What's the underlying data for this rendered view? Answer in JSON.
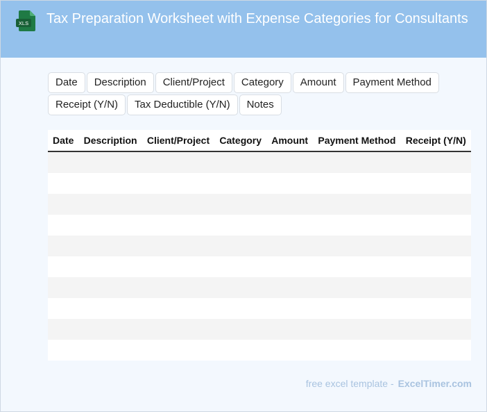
{
  "header": {
    "title": "Tax Preparation Worksheet with Expense Categories for Consultants",
    "icon_label": "XLS"
  },
  "columns": [
    "Date",
    "Description",
    "Client/Project",
    "Category",
    "Amount",
    "Payment Method",
    "Receipt (Y/N)",
    "Tax Deductible (Y/N)",
    "Notes"
  ],
  "table": {
    "headers": [
      "Date",
      "Description",
      "Client/Project",
      "Category",
      "Amount",
      "Payment Method",
      "Receipt (Y/N)"
    ],
    "empty_row_count": 10
  },
  "footer": {
    "text": "free excel template -",
    "brand": "ExcelTimer.com"
  },
  "colors": {
    "header_bg": "#94c1ec",
    "page_bg": "#f3f8fe",
    "icon_green": "#1f7a45",
    "row_stripe": "#f4f4f4",
    "footer_text": "#a9c3e0"
  }
}
